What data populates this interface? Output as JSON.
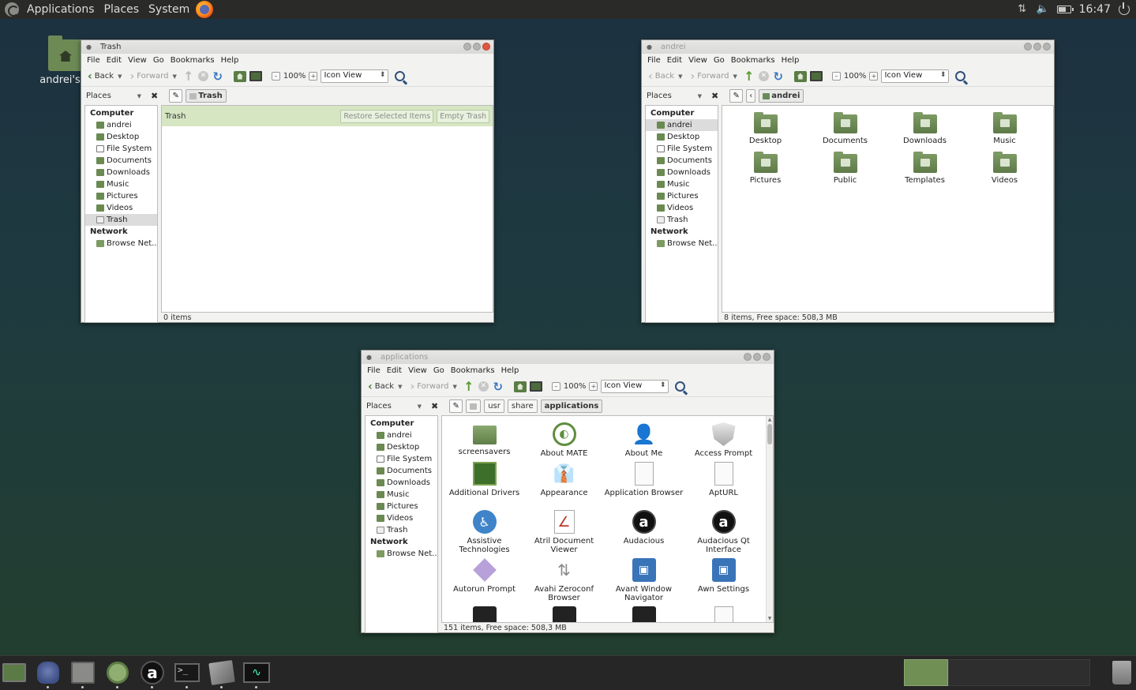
{
  "top_panel": {
    "menus": [
      "Applications",
      "Places",
      "System"
    ],
    "clock": "16:47"
  },
  "desktop": {
    "home_icon_label": "andrei's H"
  },
  "menubar": [
    "File",
    "Edit",
    "View",
    "Go",
    "Bookmarks",
    "Help"
  ],
  "toolbar": {
    "back": "Back",
    "forward": "Forward",
    "zoom": "100%",
    "view_mode": "Icon View"
  },
  "places_label": "Places",
  "sidebar": {
    "computer_header": "Computer",
    "network_header": "Network",
    "items": [
      "andrei",
      "Desktop",
      "File System",
      "Documents",
      "Downloads",
      "Music",
      "Pictures",
      "Videos",
      "Trash"
    ],
    "network_items": [
      "Browse Net..."
    ]
  },
  "trash_window": {
    "title": "Trash",
    "crumb": "Trash",
    "banner_label": "Trash",
    "restore_button": "Restore Selected Items",
    "empty_button": "Empty Trash",
    "status": "0 items"
  },
  "home_window": {
    "title": "andrei",
    "crumb": "andrei",
    "items": [
      "Desktop",
      "Documents",
      "Downloads",
      "Music",
      "Pictures",
      "Public",
      "Templates",
      "Videos"
    ],
    "status": "8 items, Free space: 508,3 MB"
  },
  "apps_window": {
    "title": "applications",
    "crumbs": [
      "usr",
      "share",
      "applications"
    ],
    "items": [
      {
        "label": "screensavers",
        "icon": "folder-icon"
      },
      {
        "label": "About MATE",
        "icon": "mate-logo-icon"
      },
      {
        "label": "About Me",
        "icon": "person-icon"
      },
      {
        "label": "Access Prompt",
        "icon": "shield-icon"
      },
      {
        "label": "Additional Drivers",
        "icon": "chip-icon"
      },
      {
        "label": "Appearance",
        "icon": "tie-icon"
      },
      {
        "label": "Application Browser",
        "icon": "document-icon"
      },
      {
        "label": "AptURL",
        "icon": "document-icon"
      },
      {
        "label": "Assistive Technologies",
        "icon": "accessibility-icon"
      },
      {
        "label": "Atril Document Viewer",
        "icon": "pdf-icon"
      },
      {
        "label": "Audacious",
        "icon": "audacious-icon"
      },
      {
        "label": "Audacious Qt Interface",
        "icon": "audacious-icon"
      },
      {
        "label": "Autorun Prompt",
        "icon": "diamond-icon"
      },
      {
        "label": "Avahi Zeroconf Browser",
        "icon": "arrows-icon"
      },
      {
        "label": "Avant Window Navigator",
        "icon": "navigator-icon"
      },
      {
        "label": "Awn Settings",
        "icon": "navigator-icon"
      },
      {
        "label": "",
        "icon": "terminal-icon"
      },
      {
        "label": "",
        "icon": "terminal-icon"
      },
      {
        "label": "",
        "icon": "terminal-icon"
      },
      {
        "label": "",
        "icon": "text-file-icon"
      }
    ],
    "status": "151 items, Free space: 508,3 MB"
  },
  "colors": {
    "accent_green": "#5f8d3d",
    "trash_banner": "#d6e6c3",
    "close_button": "#e0553c"
  }
}
